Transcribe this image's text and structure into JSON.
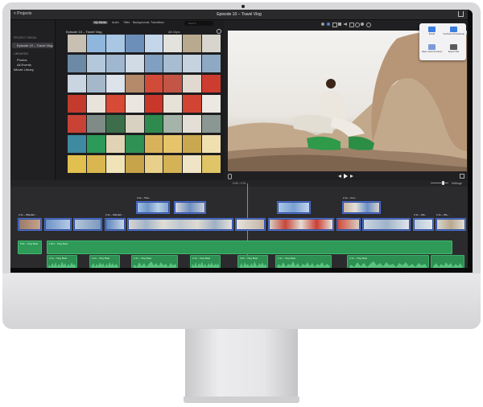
{
  "window": {
    "back_label": "< Projects",
    "title": "Episode 10 – Travel Vlog"
  },
  "library": {
    "project_media_heading": "PROJECT MEDIA",
    "project_item": "Episode 10 – Travel Vlog",
    "libraries_heading": "LIBRARIES",
    "items": [
      "Photos",
      "All Events",
      "iMovie Library"
    ]
  },
  "browser": {
    "tabs": [
      "My Media",
      "Audio",
      "Titles",
      "Backgrounds",
      "Transitions"
    ],
    "episode_label": "Episode 10 – Travel Vlog",
    "filter_label": "All Clips",
    "search_placeholder": "Search"
  },
  "share_popover": {
    "items": [
      "Email",
      "YouTube & Facebook",
      "Save Current Frame",
      "Export File"
    ]
  },
  "timeline": {
    "timecode": "0:06 / 2:29",
    "settings_label": "Settings",
    "clip_labels": [
      "2.1s – Wanderi...",
      "2.1s – Wanderi...",
      "3.1s – Trav...",
      "2.1s – Con...",
      "2.1s – Wa...",
      "2.1s – Wa..."
    ],
    "music_labels": [
      "5.5s – Vlog Beat",
      "1.8m – Vlog Beat"
    ],
    "audio_labels": [
      "2.1s – Vlog Beat",
      "2.1s – Vlog Beat",
      "2.1s – Vlog Beat",
      "2.1s – Vlog Beat",
      "3.0s – Vlog Beat",
      "2.1s – Vlog Beat",
      "2.1s – Vlog Beat"
    ]
  },
  "colors": {
    "video_clip": "#324f9c",
    "music_track": "#2f9a58",
    "accent": "#3b7ee0"
  }
}
